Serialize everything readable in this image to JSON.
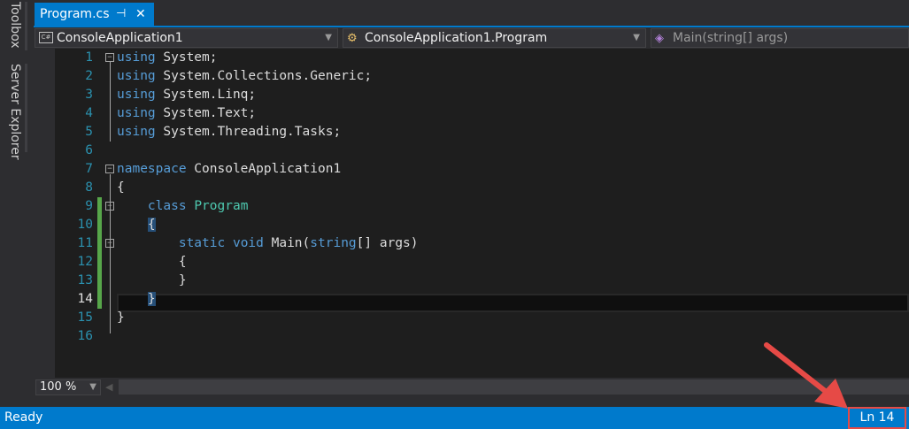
{
  "tool_strip": {
    "toolbox_label": "Toolbox",
    "server_explorer_label": "Server Explorer"
  },
  "tabs": {
    "active_file": "Program.cs",
    "pin_icon": "pin-icon",
    "close_icon": "close-icon"
  },
  "navigation": {
    "project": "ConsoleApplication1",
    "class": "ConsoleApplication1.Program",
    "member": "Main(string[] args)"
  },
  "code_lines": [
    {
      "n": "1",
      "text": "using System;"
    },
    {
      "n": "2",
      "text": "using System.Collections.Generic;"
    },
    {
      "n": "3",
      "text": "using System.Linq;"
    },
    {
      "n": "4",
      "text": "using System.Text;"
    },
    {
      "n": "5",
      "text": "using System.Threading.Tasks;"
    },
    {
      "n": "6",
      "text": ""
    },
    {
      "n": "7",
      "text": "namespace ConsoleApplication1"
    },
    {
      "n": "8",
      "text": "{"
    },
    {
      "n": "9",
      "text": "class Program"
    },
    {
      "n": "10",
      "text": "{"
    },
    {
      "n": "11",
      "text": "static void Main(string[] args)"
    },
    {
      "n": "12",
      "text": "{"
    },
    {
      "n": "13",
      "text": "}"
    },
    {
      "n": "14",
      "text": "}"
    },
    {
      "n": "15",
      "text": "}"
    },
    {
      "n": "16",
      "text": ""
    }
  ],
  "editor": {
    "zoom": "100 %",
    "current_line": 14
  },
  "status": {
    "text": "Ready",
    "line_indicator": "Ln 14"
  },
  "colors": {
    "accent": "#007acc",
    "keyword": "#569cd6",
    "type": "#4ec9b0",
    "line_number": "#2b91af",
    "change_marker": "#57a64a",
    "annotation": "#e64a46"
  }
}
